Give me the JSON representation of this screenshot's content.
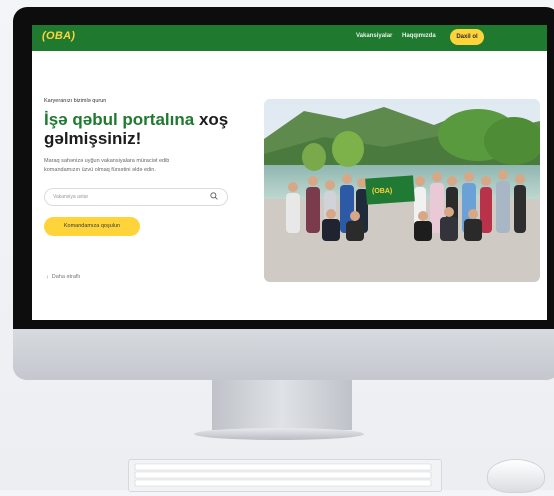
{
  "nav": {
    "logo": "(OBA)",
    "links": [
      "Vakansiyalar",
      "Haqqımızda"
    ],
    "login_label": "Daxil ol"
  },
  "hero": {
    "kicker": "Karyeranızı bizimlə qurun",
    "title_green": "İşə qəbul portalına",
    "title_dark_1": "xoş",
    "title_dark_2": "gəlmişsiniz!",
    "description": "Maraq sahənizə uyğun vakansiyalara müraciət edib komandamızın üzvü olmaq fürsətini əldə edin.",
    "search_placeholder": "Vakansiya axtar",
    "join_button": "Komandamıza qoşulun",
    "more_link": "Daha ətraflı"
  },
  "photo": {
    "banner_text": "(OBA)"
  },
  "colors": {
    "brand_green": "#1f7a2f",
    "accent_yellow": "#ffd43b"
  },
  "icons": {
    "search": "search-icon",
    "arrow_down": "arrow-down-icon"
  }
}
